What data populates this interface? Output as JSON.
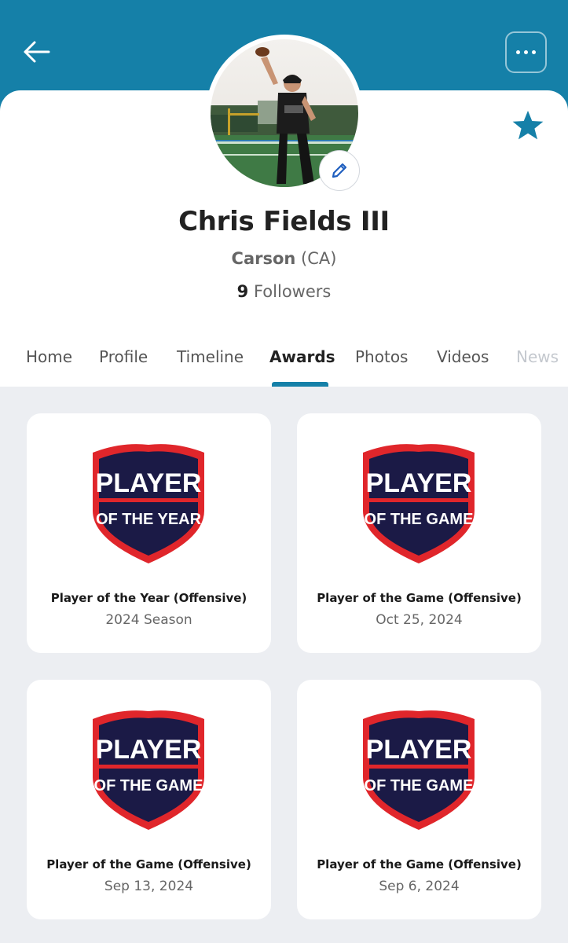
{
  "header": {
    "background_color": "#1580a8",
    "back_icon": "arrow-left-icon",
    "more_icon": "more-horizontal-icon"
  },
  "profile": {
    "name": "Chris Fields III",
    "city": "Carson",
    "state": "(CA)",
    "followers_count": "9",
    "followers_label": "Followers",
    "favorite_icon": "star-icon",
    "edit_icon": "pencil-icon"
  },
  "tabs": [
    {
      "label": "Home"
    },
    {
      "label": "Profile"
    },
    {
      "label": "Timeline"
    },
    {
      "label": "Awards"
    },
    {
      "label": "Photos"
    },
    {
      "label": "Videos"
    },
    {
      "label": "News"
    }
  ],
  "active_tab": "Awards",
  "awards": [
    {
      "badge_top": "PLAYER",
      "badge_bottom": "OF THE YEAR",
      "title": "Player of the Year (Offensive)",
      "date": "2024 Season"
    },
    {
      "badge_top": "PLAYER",
      "badge_bottom": "OF THE GAME",
      "title": "Player of the Game (Offensive)",
      "date": "Oct 25, 2024"
    },
    {
      "badge_top": "PLAYER",
      "badge_bottom": "OF THE GAME",
      "title": "Player of the Game (Offensive)",
      "date": "Sep 13, 2024"
    },
    {
      "badge_top": "PLAYER",
      "badge_bottom": "OF THE GAME",
      "title": "Player of the Game (Offensive)",
      "date": "Sep 6, 2024"
    }
  ],
  "colors": {
    "accent": "#1580a8",
    "badge_red": "#e0262b",
    "badge_navy": "#1b1a46"
  }
}
